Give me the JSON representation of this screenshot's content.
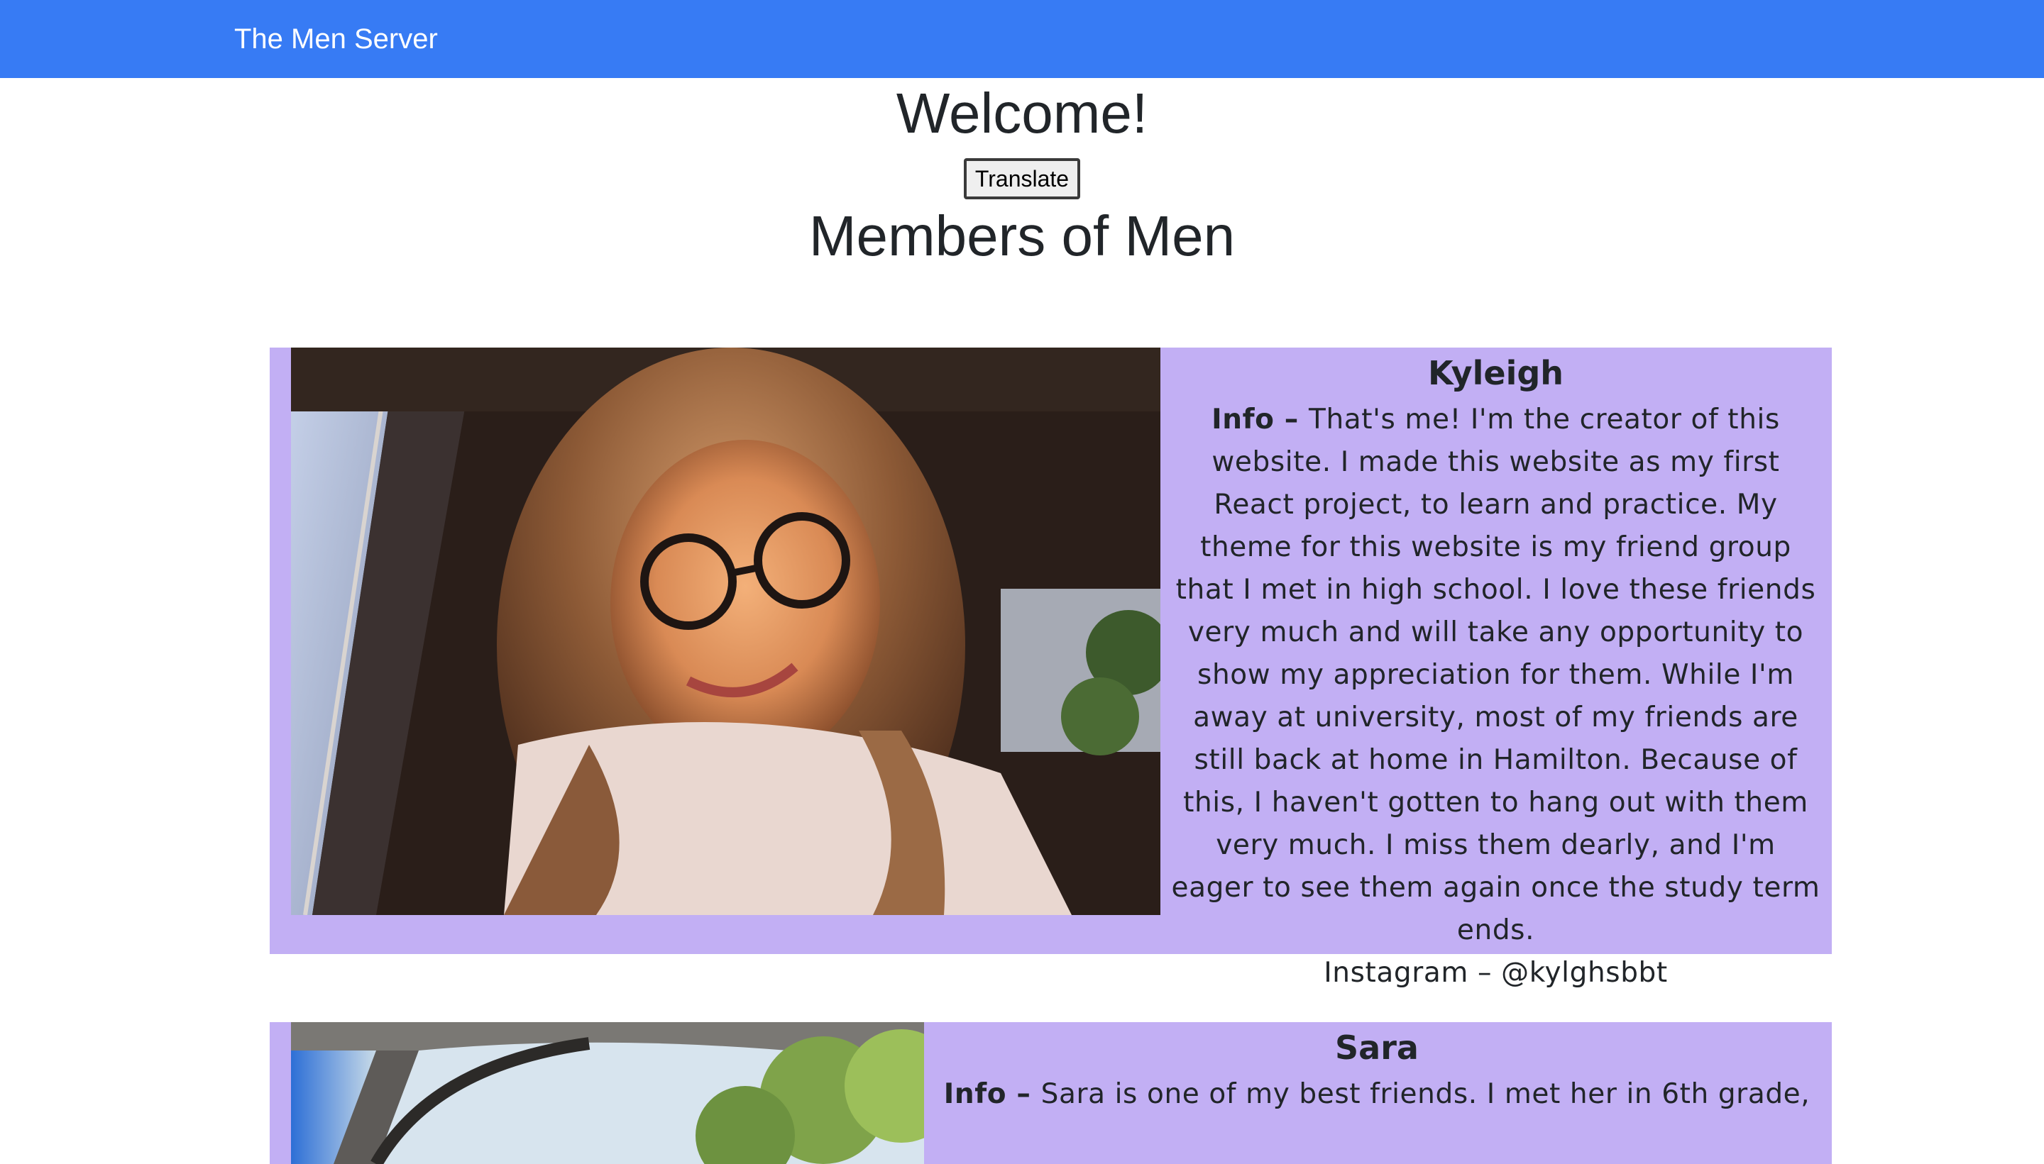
{
  "navbar": {
    "brand": "The Men Server",
    "color": "#377bf4"
  },
  "header": {
    "welcome": "Welcome!",
    "translate_label": "Translate",
    "members_title": "Members of Men"
  },
  "card_color": "#c2aff4",
  "members": [
    {
      "name": "Kyleigh",
      "info_label": "Info – ",
      "bio": "That's me! I'm the creator of this website. I made this website as my first React project, to learn and practice. My theme for this website is my friend group that I met in high school. I love these friends very much and will take any opportunity to show my appreciation for them. While I'm away at university, most of my friends are still back at home in Hamilton. Because of this, I haven't gotten to hang out with them very much. I miss them dearly, and I'm eager to see them again once the study term ends.",
      "instagram": "Instagram – @kylghsbbt"
    },
    {
      "name": "Sara",
      "info_label": "Info – ",
      "bio": "Sara is one of my best friends. I met her in 6th grade,"
    }
  ]
}
